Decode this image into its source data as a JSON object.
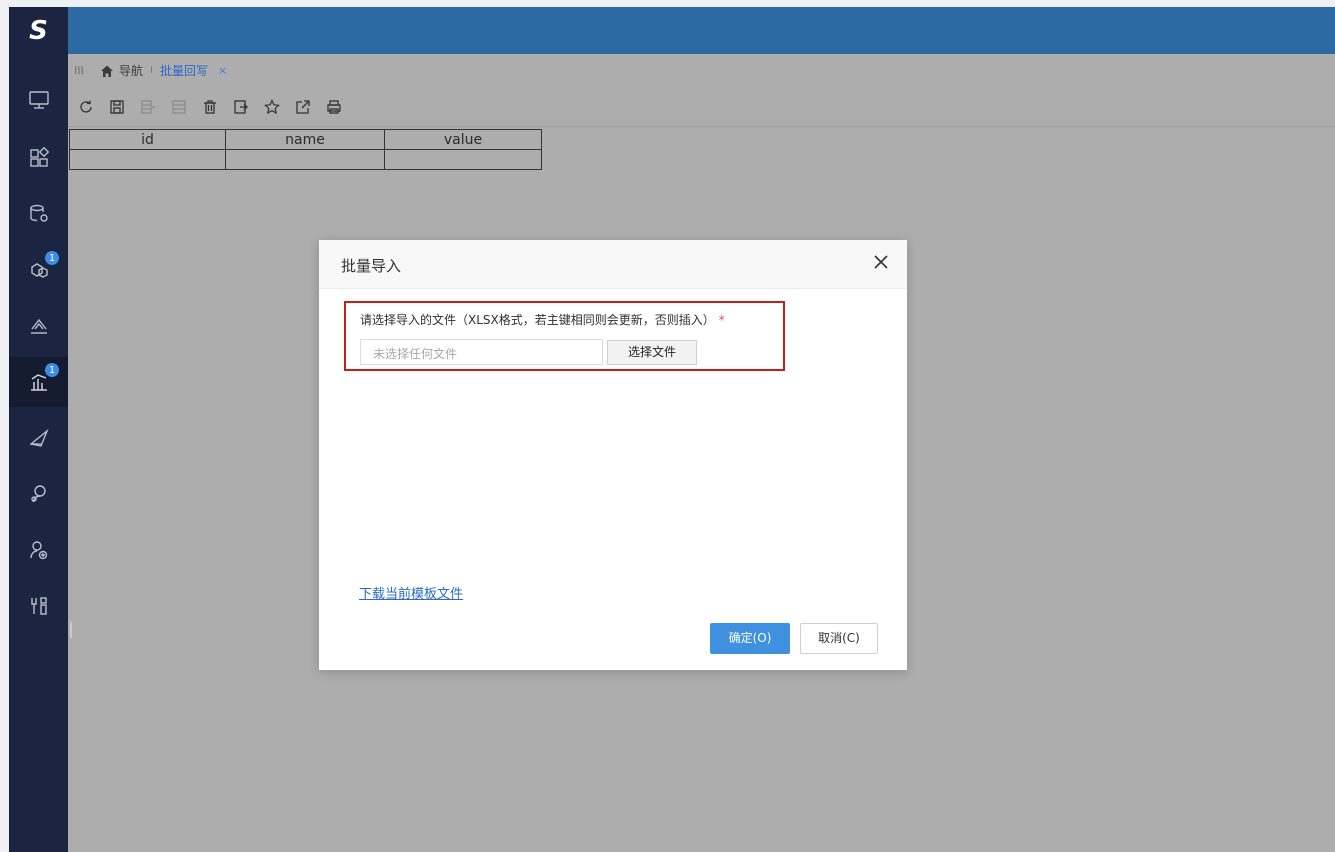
{
  "app": {
    "logo_text": "S"
  },
  "sidebar": {
    "items": [
      {
        "icon": "monitor-icon",
        "badge": ""
      },
      {
        "icon": "apps-grid-icon",
        "badge": ""
      },
      {
        "icon": "database-settings-icon",
        "badge": ""
      },
      {
        "icon": "cubes-icon",
        "badge": "1"
      },
      {
        "icon": "layers-chart-icon",
        "badge": ""
      },
      {
        "icon": "bar-chart-icon",
        "badge": "1",
        "active": true
      },
      {
        "icon": "send-icon",
        "badge": ""
      },
      {
        "icon": "user-settings-icon",
        "badge": ""
      },
      {
        "icon": "user-add-icon",
        "badge": ""
      },
      {
        "icon": "tools-icon",
        "badge": ""
      }
    ]
  },
  "tabbar": {
    "nav_label": "导航",
    "separator": "I",
    "active_tab": "批量回写",
    "close_label": "×"
  },
  "toolbar": {
    "tools": [
      "refresh-icon",
      "save-icon",
      "insert-row-icon",
      "delete-row-icon",
      "trash-icon",
      "import-icon",
      "favorite-star-icon",
      "export-icon",
      "print-icon"
    ]
  },
  "grid": {
    "columns": [
      "id",
      "name",
      "value"
    ],
    "rows": [
      [
        "",
        "",
        ""
      ]
    ]
  },
  "dialog": {
    "title": "批量导入",
    "close_label": "×",
    "field_label": "请选择导入的文件（XLSX格式，若主键相同则会更新，否则插入）",
    "required_mark": "*",
    "file_placeholder": "未选择任何文件",
    "choose_file_button": "选择文件",
    "download_link": "下载当前模板文件",
    "ok_button": "确定(O)",
    "cancel_button": "取消(C)"
  }
}
